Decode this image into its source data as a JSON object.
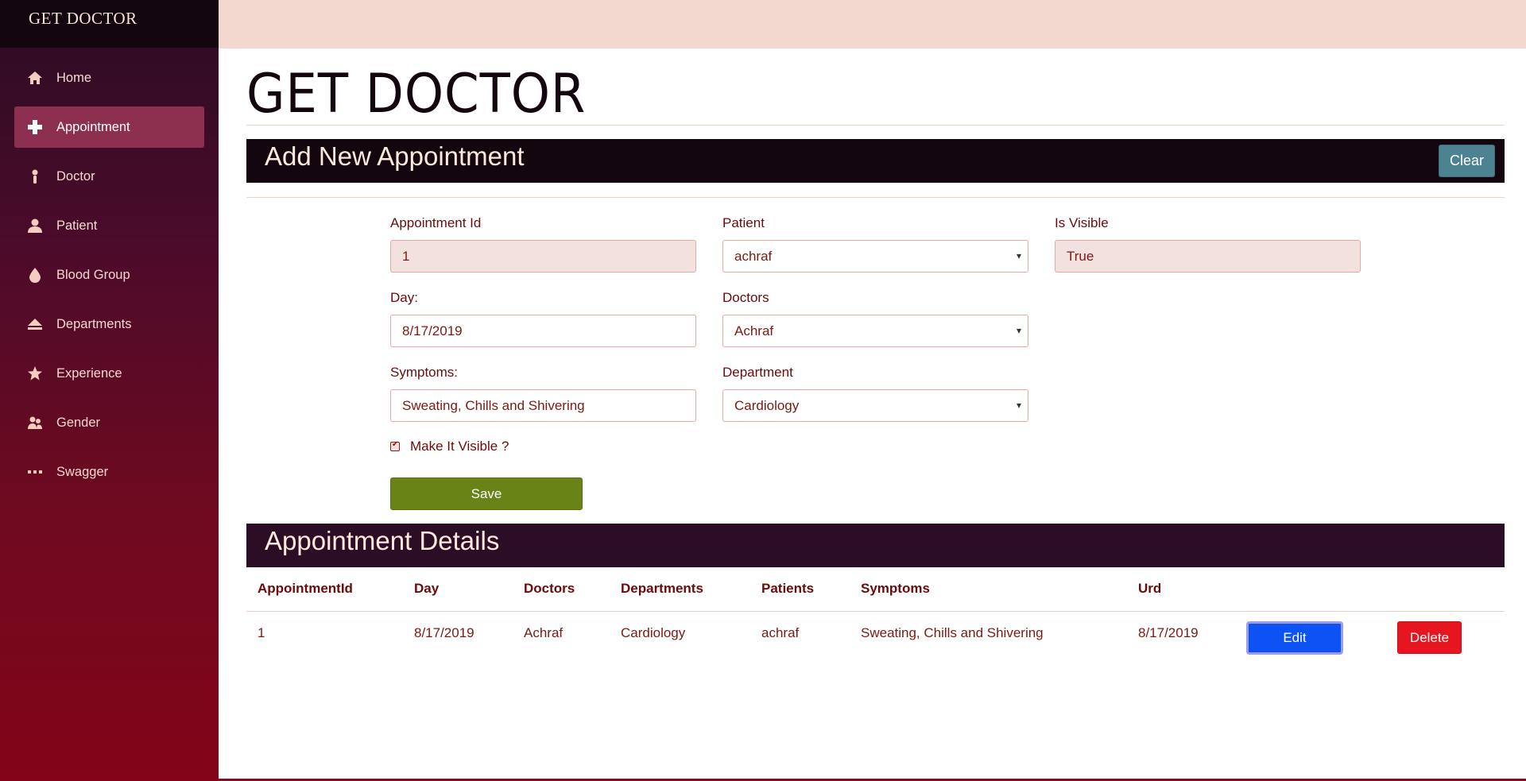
{
  "app": {
    "brand": "GET DOCTOR",
    "page_title": "GET DOCTOR"
  },
  "sidebar": {
    "items": [
      {
        "label": "Home",
        "icon": "home-icon",
        "active": false
      },
      {
        "label": "Appointment",
        "icon": "medical-cross-icon",
        "active": true
      },
      {
        "label": "Doctor",
        "icon": "doctor-icon",
        "active": false
      },
      {
        "label": "Patient",
        "icon": "patient-icon",
        "active": false
      },
      {
        "label": "Blood Group",
        "icon": "blood-drop-icon",
        "active": false
      },
      {
        "label": "Departments",
        "icon": "eject-icon",
        "active": false
      },
      {
        "label": "Experience",
        "icon": "star-icon",
        "active": false
      },
      {
        "label": "Gender",
        "icon": "users-icon",
        "active": false
      },
      {
        "label": "Swagger",
        "icon": "ellipsis-icon",
        "active": false
      }
    ]
  },
  "form": {
    "heading": "Add New Appointment",
    "clear_label": "Clear",
    "appointment_id": {
      "label": "Appointment Id",
      "value": "1"
    },
    "patient": {
      "label": "Patient",
      "value": "achraf"
    },
    "is_visible": {
      "label": "Is Visible",
      "value": "True"
    },
    "day": {
      "label": "Day:",
      "value": "8/17/2019"
    },
    "doctors": {
      "label": "Doctors",
      "value": "Achraf"
    },
    "symptoms": {
      "label": "Symptoms:",
      "value": "Sweating, Chills and Shivering"
    },
    "department": {
      "label": "Department",
      "value": "Cardiology"
    },
    "make_visible": {
      "label": "Make It Visible ?",
      "checked": true
    },
    "save_label": "Save"
  },
  "details": {
    "heading": "Appointment Details",
    "columns": [
      "AppointmentId",
      "Day",
      "Doctors",
      "Departments",
      "Patients",
      "Symptoms",
      "Urd"
    ],
    "rows": [
      {
        "id": "1",
        "day": "8/17/2019",
        "doctor": "Achraf",
        "department": "Cardiology",
        "patient": "achraf",
        "symptoms": "Sweating, Chills and Shivering",
        "urd": "8/17/2019",
        "edit_label": "Edit",
        "delete_label": "Delete"
      }
    ]
  },
  "colors": {
    "sidebar_top": "#2a0d23",
    "sidebar_bottom": "#830418",
    "topbar": "#f3d8cf",
    "header_dark": "#14060f",
    "save": "#6a8316",
    "clear": "#4d8290",
    "edit": "#0d52f2",
    "delete": "#e51620"
  }
}
